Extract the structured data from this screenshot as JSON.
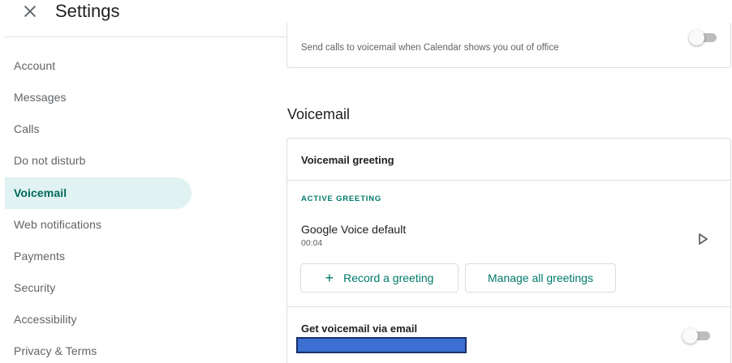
{
  "header": {
    "title": "Settings"
  },
  "sidebar": {
    "items": [
      {
        "label": "Account",
        "active": false
      },
      {
        "label": "Messages",
        "active": false
      },
      {
        "label": "Calls",
        "active": false
      },
      {
        "label": "Do not disturb",
        "active": false
      },
      {
        "label": "Voicemail",
        "active": true
      },
      {
        "label": "Web notifications",
        "active": false
      },
      {
        "label": "Payments",
        "active": false
      },
      {
        "label": "Security",
        "active": false
      },
      {
        "label": "Accessibility",
        "active": false
      },
      {
        "label": "Privacy & Terms",
        "active": false
      }
    ]
  },
  "main": {
    "out_of_office": {
      "text": "Send calls to voicemail when Calendar shows you out of office",
      "enabled": false
    },
    "section_title": "Voicemail",
    "voicemail_card": {
      "greeting_title": "Voicemail greeting",
      "active_label": "ACTIVE GREETING",
      "greeting_name": "Google Voice default",
      "greeting_duration": "00:04",
      "record_button": "Record a greeting",
      "manage_button": "Manage all greetings",
      "email_title": "Get voicemail via email",
      "email_enabled": false
    }
  },
  "colors": {
    "accent": "#00796b",
    "active_bg": "#e0f2f1",
    "redaction": "#3b6fd1"
  }
}
